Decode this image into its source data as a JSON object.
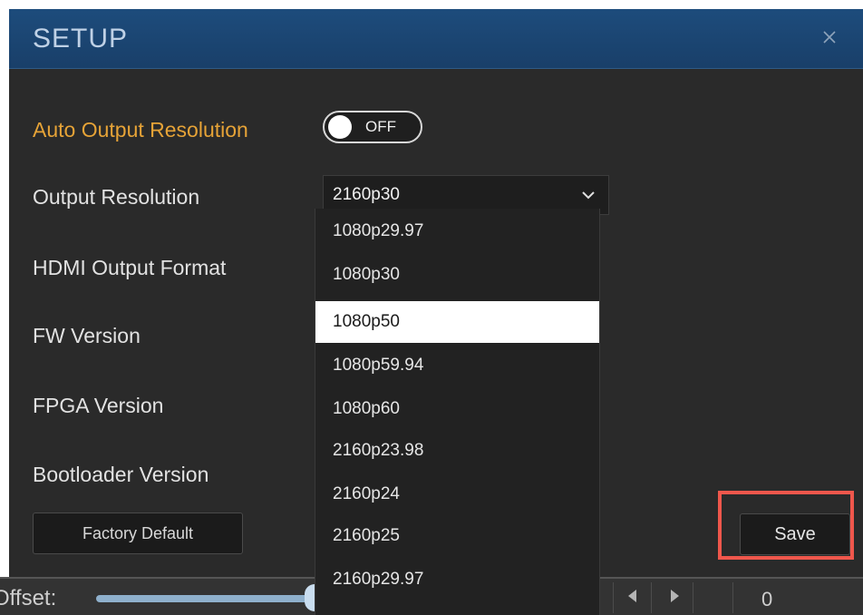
{
  "dialog": {
    "title": "SETUP",
    "close_icon": "close-icon"
  },
  "settings": {
    "auto_output_resolution": {
      "label": "Auto Output Resolution",
      "toggle_state": "OFF",
      "label_color": "#e6a337"
    },
    "output_resolution": {
      "label": "Output Resolution",
      "selected_value": "2160p30",
      "options": [
        "1080p29.97",
        "1080p30",
        "1080p50",
        "1080p59.94",
        "1080p60",
        "2160p23.98",
        "2160p24",
        "2160p25",
        "2160p29.97"
      ],
      "highlighted_option": "1080p50"
    },
    "hdmi_output_format": {
      "label": "HDMI Output Format"
    },
    "fw_version": {
      "label": "FW Version"
    },
    "fpga_version": {
      "label": "FPGA Version"
    },
    "bootloader_version": {
      "label": "Bootloader Version"
    }
  },
  "buttons": {
    "factory_default": "Factory Default",
    "save": "Save"
  },
  "background": {
    "offset_label": "Offset:",
    "offset_value": "0"
  },
  "colors": {
    "title_bar": "#1d4c7c",
    "dialog_bg": "#2a2a2a",
    "accent": "#e6a337",
    "highlight_box": "#f0574c"
  }
}
